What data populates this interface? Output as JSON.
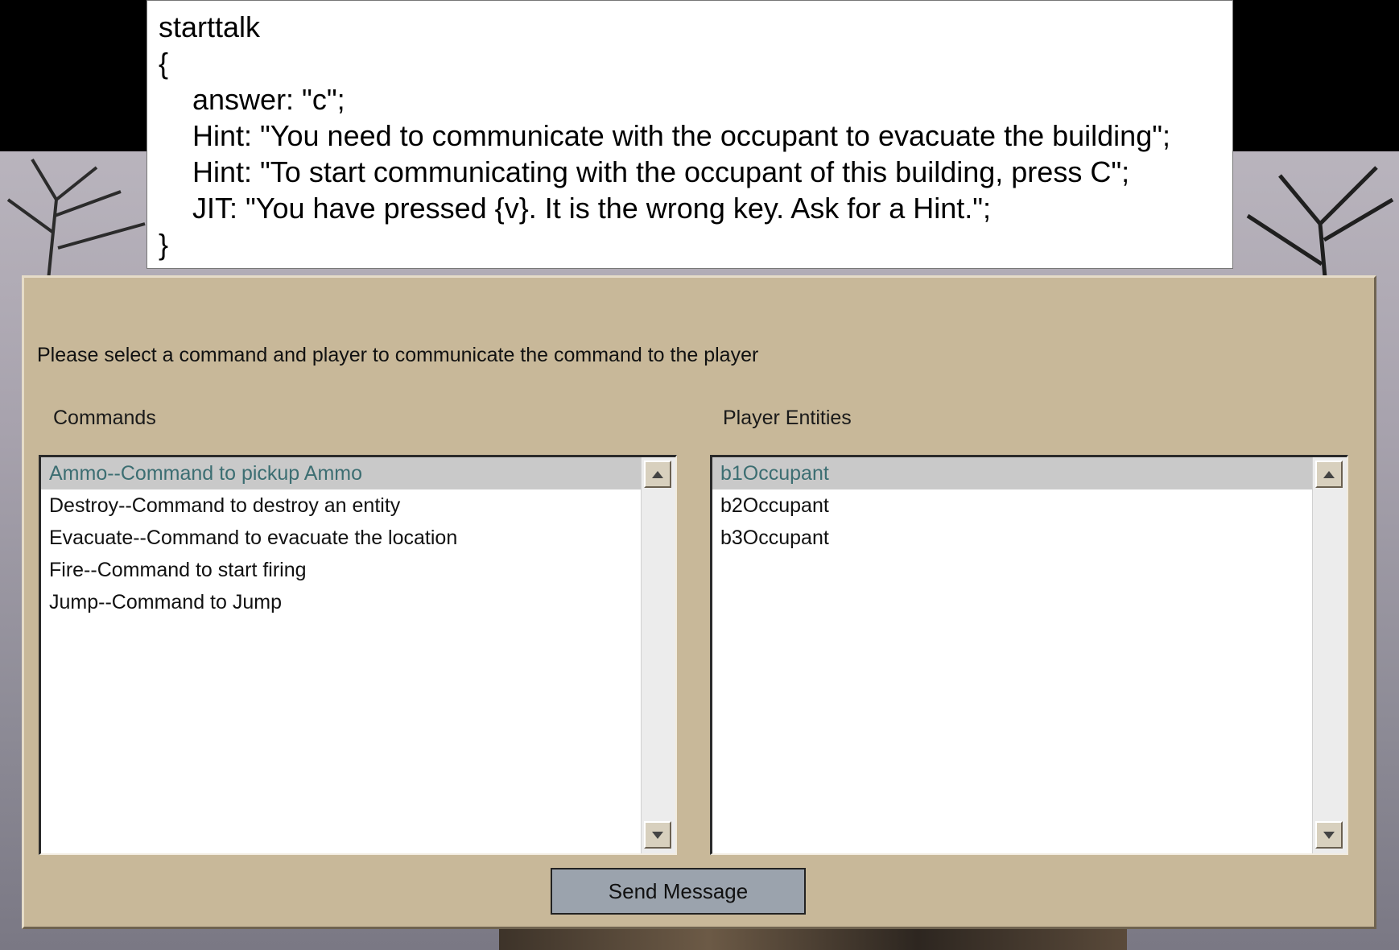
{
  "code": {
    "lines": [
      "starttalk",
      "{",
      "answer: \"c\";",
      "Hint: \"You need to communicate with the occupant to evacuate the building\";",
      "Hint: \"To start communicating with the occupant of this building, press C\";",
      "JIT: \"You have pressed {v}. It is the wrong key. Ask for a Hint.\";",
      "}"
    ]
  },
  "dialog": {
    "prompt": "Please select a command and player to communicate the command to the player",
    "commands": {
      "label": "Commands",
      "items": [
        "Ammo--Command to pickup Ammo",
        "Destroy--Command to destroy an entity",
        "Evacuate--Command to evacuate the location",
        "Fire--Command to start firing",
        "Jump--Command to Jump"
      ],
      "selected_index": 0
    },
    "players": {
      "label": "Player Entities",
      "items": [
        "b1Occupant",
        "b2Occupant",
        "b3Occupant"
      ],
      "selected_index": 0
    },
    "send_label": "Send Message"
  },
  "colors": {
    "dialog_bg": "#c8b899",
    "selected_bg": "#c9c9c9",
    "selected_text": "#3c6e72",
    "button_bg": "#9ba3ad"
  }
}
